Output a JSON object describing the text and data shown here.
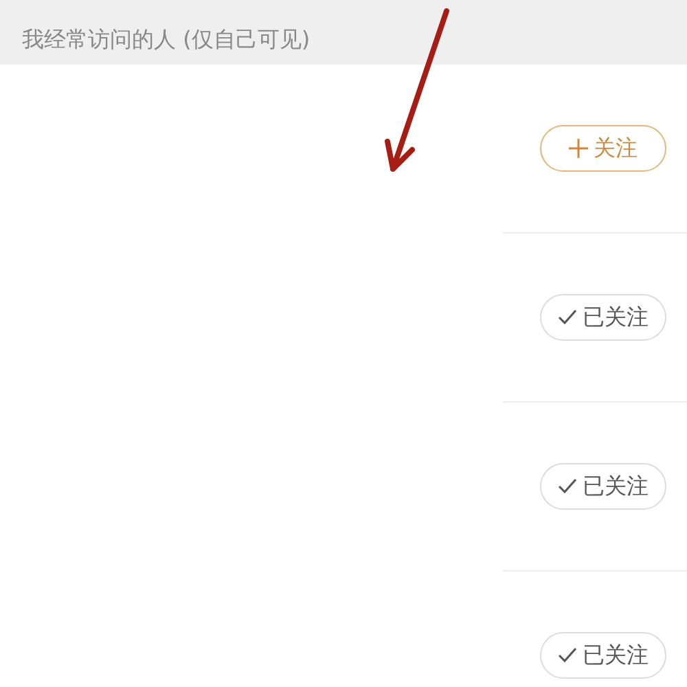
{
  "section_header": "我经常访问的人 (仅自己可见)",
  "people": [
    {
      "button": "关注",
      "followed": false
    },
    {
      "button": "已关注",
      "followed": true
    },
    {
      "button": "已关注",
      "followed": true
    },
    {
      "button": "已关注",
      "followed": true
    }
  ]
}
